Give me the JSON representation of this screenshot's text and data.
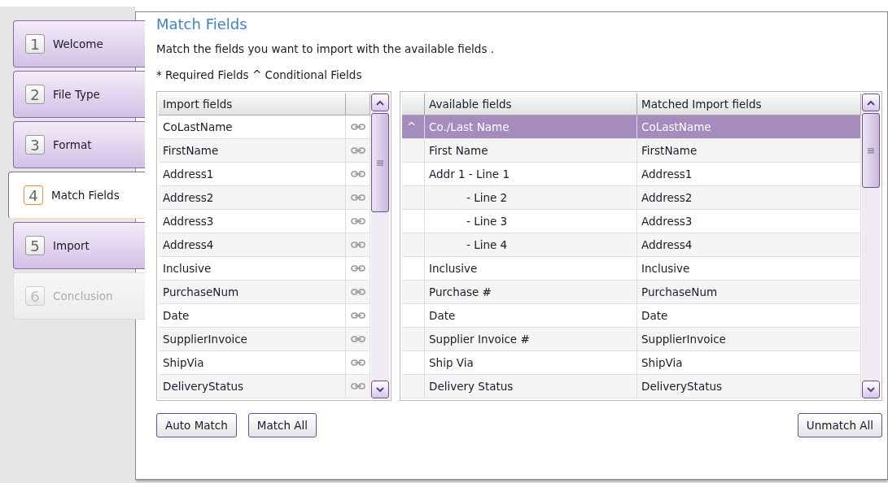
{
  "steps": [
    {
      "number": "1",
      "label": "Welcome",
      "selected": false,
      "disabled": false
    },
    {
      "number": "2",
      "label": "File Type",
      "selected": false,
      "disabled": false
    },
    {
      "number": "3",
      "label": "Format",
      "selected": false,
      "disabled": false
    },
    {
      "number": "4",
      "label": "Match Fields",
      "selected": true,
      "disabled": false
    },
    {
      "number": "5",
      "label": "Import",
      "selected": false,
      "disabled": false
    },
    {
      "number": "6",
      "label": "Conclusion",
      "selected": false,
      "disabled": true
    }
  ],
  "title": "Match Fields",
  "instruction": "Match the fields you want to import with the available fields .",
  "legend": "* Required Fields ^ Conditional Fields",
  "import_table": {
    "columns": [
      "Import fields"
    ],
    "rows": [
      "CoLastName",
      "FirstName",
      "Address1",
      "Address2",
      "Address3",
      "Address4",
      "Inclusive",
      "PurchaseNum",
      "Date",
      "SupplierInvoice",
      "ShipVia",
      "DeliveryStatus"
    ]
  },
  "match_table": {
    "columns": [
      "Available fields",
      "Matched Import fields"
    ],
    "rows": [
      {
        "marker": "^",
        "available": "Co./Last Name",
        "matched": "CoLastName",
        "indented": false,
        "selected": true
      },
      {
        "available": "First Name",
        "matched": "FirstName",
        "indented": false,
        "selected": false
      },
      {
        "available": "Addr 1 - Line 1",
        "matched": "Address1",
        "indented": false,
        "selected": false
      },
      {
        "available": "- Line 2",
        "matched": "Address2",
        "indented": true,
        "selected": false
      },
      {
        "available": "- Line 3",
        "matched": "Address3",
        "indented": true,
        "selected": false
      },
      {
        "available": "- Line 4",
        "matched": "Address4",
        "indented": true,
        "selected": false
      },
      {
        "available": "Inclusive",
        "matched": "Inclusive",
        "indented": false,
        "selected": false
      },
      {
        "available": "Purchase #",
        "matched": "PurchaseNum",
        "indented": false,
        "selected": false
      },
      {
        "available": "Date",
        "matched": "Date",
        "indented": false,
        "selected": false
      },
      {
        "available": "Supplier Invoice #",
        "matched": "SupplierInvoice",
        "indented": false,
        "selected": false
      },
      {
        "available": "Ship Via",
        "matched": "ShipVia",
        "indented": false,
        "selected": false
      },
      {
        "available": "Delivery Status",
        "matched": "DeliveryStatus",
        "indented": false,
        "selected": false
      }
    ]
  },
  "left_buttons": [
    "Auto Match",
    "Match All"
  ],
  "right_buttons": [
    "Unmatch All"
  ]
}
